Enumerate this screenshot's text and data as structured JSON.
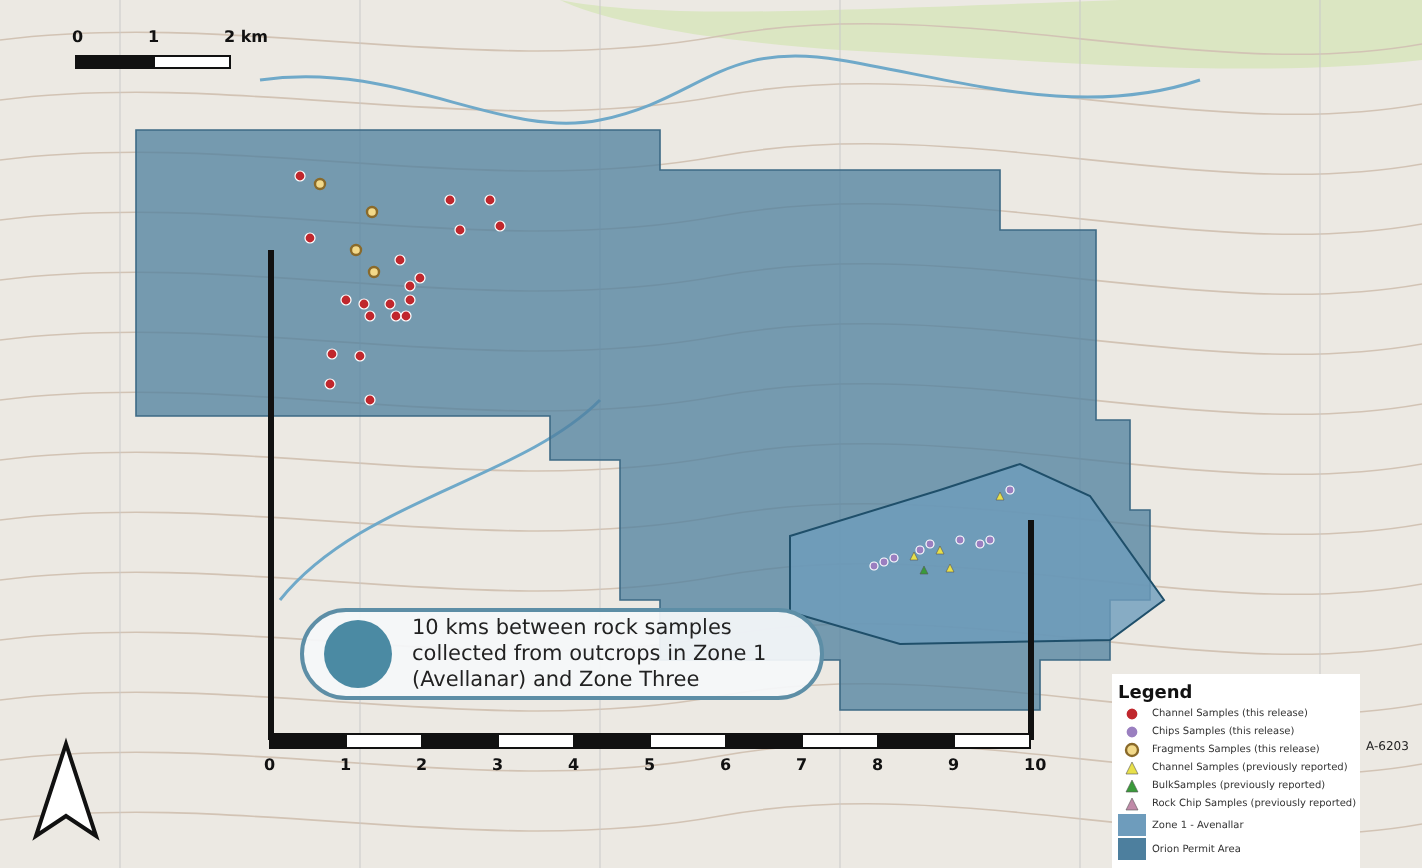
{
  "top_scale": {
    "labels": [
      "0",
      "1",
      "2 km"
    ]
  },
  "callout": {
    "text": "10 kms between rock samples collected from outcrops in Zone 1 (Avellanar) and Zone Three"
  },
  "distance_scale": {
    "ticks": [
      "0",
      "1",
      "2",
      "3",
      "4",
      "5",
      "6",
      "7",
      "8",
      "9",
      "10"
    ]
  },
  "road_label": "A-6203",
  "legend": {
    "title": "Legend",
    "items": [
      {
        "label": "Channel Samples (this release)",
        "kind": "dot",
        "color": "#c0272d"
      },
      {
        "label": "Chips Samples (this release)",
        "kind": "dot",
        "color": "#9a7fc0"
      },
      {
        "label": "Fragments Samples (this release)",
        "kind": "ring",
        "color": "#8a6a2a"
      },
      {
        "label": "Channel Samples (previously reported)",
        "kind": "triangle",
        "color": "#e8e04a"
      },
      {
        "label": "BulkSamples (previously reported)",
        "kind": "triangle",
        "color": "#3a9a3a"
      },
      {
        "label": "Rock Chip Samples (previously reported)",
        "kind": "triangle",
        "color": "#c08aa8"
      },
      {
        "label": "Zone 1 - Avenallar",
        "kind": "swatch",
        "color": "#6e9cbc"
      },
      {
        "label": "Orion Permit Area",
        "kind": "swatch",
        "color": "#4d7f9e"
      }
    ]
  }
}
